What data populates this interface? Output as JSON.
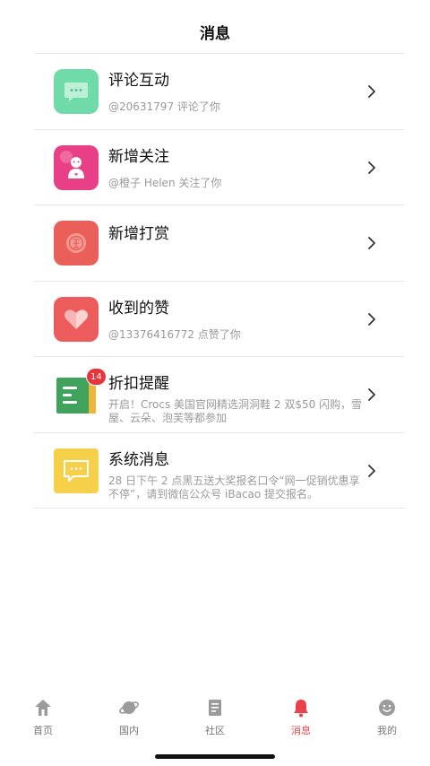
{
  "header": {
    "title": "消息"
  },
  "rows": [
    {
      "title": "评论互动",
      "subtitle": "@20631797 评论了你",
      "icon": "comment-bubble-icon",
      "color": "#6fdba8"
    },
    {
      "title": "新增关注",
      "subtitle": "@橙子 Helen 关注了你",
      "icon": "follower-figure-icon",
      "color": "#e93f86"
    },
    {
      "title": "新增打赏",
      "subtitle": "",
      "icon": "reward-coin-icon",
      "color": "#ea5f5a"
    },
    {
      "title": "收到的赞",
      "subtitle": "@13376416772 点赞了你",
      "icon": "heart-icon",
      "color": "#ec5c5c"
    },
    {
      "title": "折扣提醒",
      "subtitle": "开启！Crocs 美国官网精选洞洞鞋 2 双$50 闪购，雪屋、云朵、泡芙等都参加",
      "icon": "discount-notebook-icon",
      "color": "#3fa35b",
      "badge": "14"
    },
    {
      "title": "系统消息",
      "subtitle": "28 日下午 2 点黑五送大奖报名口令“网一促销优惠享不停”，请到微信公众号 iBacao 提交报名。",
      "icon": "system-message-icon",
      "color": "#f7d04a"
    }
  ],
  "tabs": [
    {
      "label": "首页",
      "icon": "home-icon"
    },
    {
      "label": "国内",
      "icon": "planet-icon"
    },
    {
      "label": "社区",
      "icon": "book-icon"
    },
    {
      "label": "消息",
      "icon": "bell-icon",
      "active": true
    },
    {
      "label": "我的",
      "icon": "smiley-icon"
    }
  ],
  "colors": {
    "accent": "#e8424c",
    "badge": "#e8343b",
    "divider": "#e6e6e6"
  }
}
